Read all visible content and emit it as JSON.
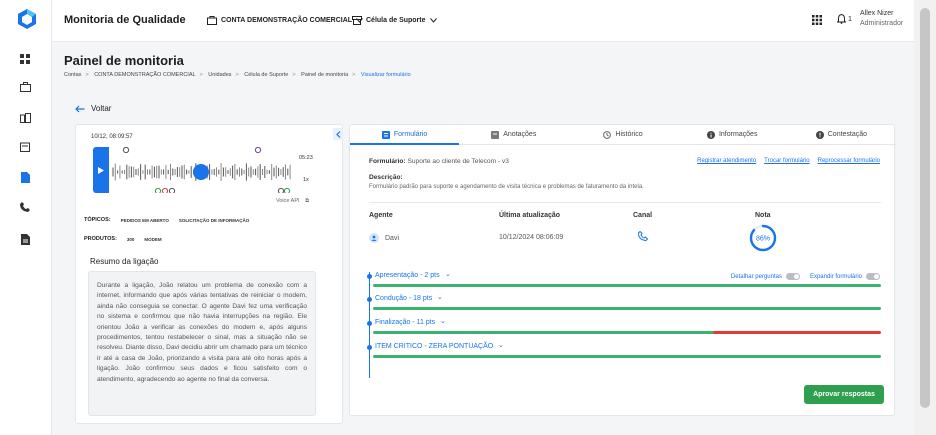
{
  "header": {
    "app_title": "Monitoria de Qualidade",
    "account_selector": "CONTA DEMONSTRAÇÃO COMERCIAL",
    "team_selector": "Célula de Suporte",
    "notifications_count": "1",
    "user_name": "Allex Nizer",
    "user_role": "Administrador"
  },
  "page": {
    "title": "Painel de monitoria",
    "breadcrumb": [
      "Contas",
      "CONTA DEMONSTRAÇÃO COMERCIAL",
      "Unidades",
      "Célula de Suporte",
      "Painel de monitoria",
      "Visualizar formulário"
    ],
    "back_label": "Voltar"
  },
  "player": {
    "timestamp": "10/12, 08:09:57",
    "duration": "05:23",
    "speed": "1x",
    "voice_api_label": "Voice API",
    "topics_label": "TÓPICOS:",
    "topics": [
      "PEDIDOS EM ABERTO",
      "SOLICITAÇÃO DE INFORMAÇÃO"
    ],
    "products_label": "PRODUTOS:",
    "products": [
      "300",
      "MODEM"
    ],
    "summary_title": "Resumo da ligação",
    "summary_text": "Durante a ligação, João relatou um problema de conexão com a internet, informando que após várias tentativas de reiniciar o modem, ainda não conseguia se conectar. O agente Davi fez uma verificação no sistema e confirmou que não havia interrupções na região. Ele orientou João a verificar as conexões do modem e, após alguns procedimentos, tentou restabelecer o sinal, mas a situação não se resolveu. Diante disso, Davi decidiu abrir um chamado para um técnico ir até a casa de João, priorizando a visita para até oito horas após a ligação. João confirmou seus dados e ficou satisfeito com o atendimento, agradecendo ao agente no final da conversa."
  },
  "tabs": [
    "Formulário",
    "Anotações",
    "Histórico",
    "Informações",
    "Contestação"
  ],
  "form": {
    "form_label": "Formulário:",
    "form_name": "Suporte ao cliente de Telecom - v3",
    "links": [
      "Registrar atendimento",
      "Trocar formulário",
      "Reprocessar formulário"
    ],
    "desc_label": "Descrição:",
    "desc_text": "Formulário padrão para suporte e agendamento de visita técnica e problemas de faturamento da intela.",
    "col_agent": "Agente",
    "col_updated": "Última atualização",
    "col_channel": "Canal",
    "col_score": "Nota",
    "agent_name": "Davi",
    "updated_at": "10/12/2024 08:06:09",
    "score": "86%",
    "score_value": 86,
    "detail_toggle": "Detalhar perguntas",
    "expand_toggle": "Expandir formulário",
    "sections": [
      {
        "title": "Apresentação - 2 pts",
        "green_fraction": 1.0
      },
      {
        "title": "Condução - 18 pts",
        "green_fraction": 1.0
      },
      {
        "title": "Finalização - 11 pts",
        "green_fraction": 0.67
      },
      {
        "title": "ITEM CRITICO - ZERA PONTUAÇÃO",
        "green_fraction": 1.0
      }
    ],
    "approve_label": "Aprovar respostas"
  },
  "colors": {
    "accent": "#1a73e8",
    "success": "#3cb371",
    "danger": "#e53935",
    "approve": "#2e9e4f"
  }
}
